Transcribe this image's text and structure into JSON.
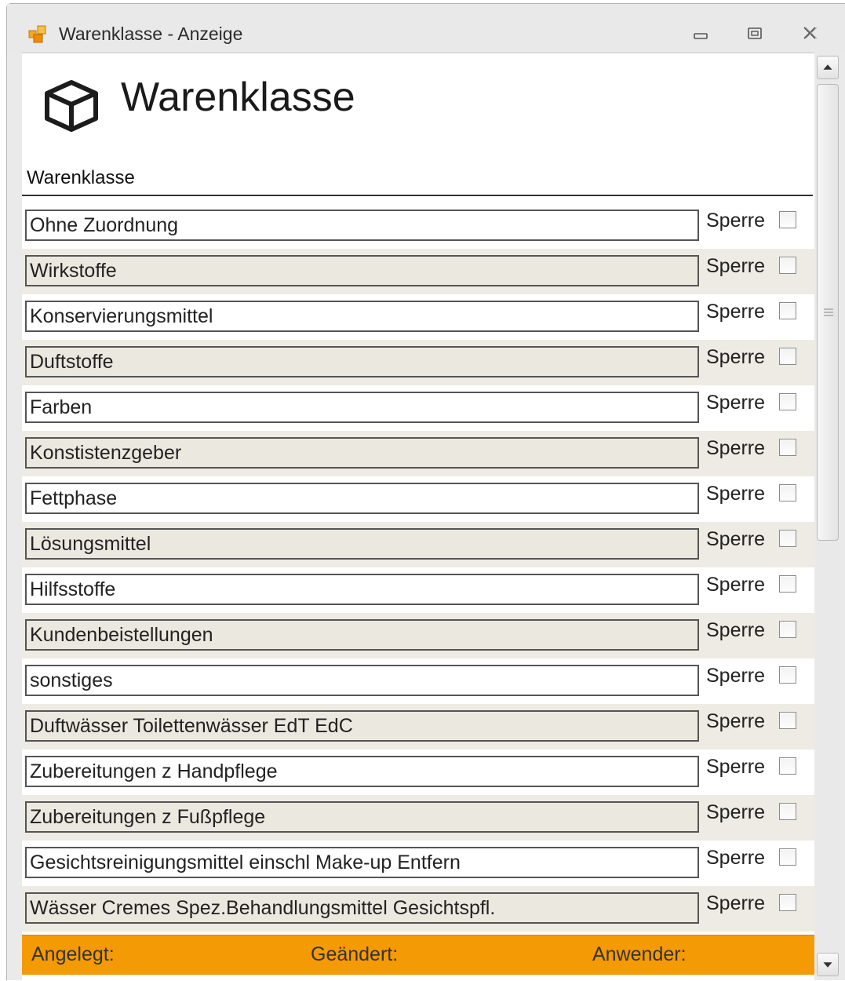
{
  "window": {
    "title": "Warenklasse - Anzeige",
    "icon": "app-icon",
    "controls": [
      "minimize-icon",
      "restore-icon",
      "close-icon"
    ]
  },
  "header": {
    "icon": "cube-icon",
    "title": "Warenklasse"
  },
  "table": {
    "column_header": "Warenklasse",
    "rows": [
      {
        "name": "Ohne Zuordnung",
        "lock_label": "Sperre",
        "locked": false
      },
      {
        "name": "Wirkstoffe",
        "lock_label": "Sperre",
        "locked": false
      },
      {
        "name": "Konservierungsmittel",
        "lock_label": "Sperre",
        "locked": false
      },
      {
        "name": "Duftstoffe",
        "lock_label": "Sperre",
        "locked": false
      },
      {
        "name": "Farben",
        "lock_label": "Sperre",
        "locked": false
      },
      {
        "name": "Konstistenzgeber",
        "lock_label": "Sperre",
        "locked": false
      },
      {
        "name": "Fettphase",
        "lock_label": "Sperre",
        "locked": false
      },
      {
        "name": "Lösungsmittel",
        "lock_label": "Sperre",
        "locked": false
      },
      {
        "name": "Hilfsstoffe",
        "lock_label": "Sperre",
        "locked": false
      },
      {
        "name": "Kundenbeistellungen",
        "lock_label": "Sperre",
        "locked": false
      },
      {
        "name": "sonstiges",
        "lock_label": "Sperre",
        "locked": false
      },
      {
        "name": "Duftwässer Toilettenwässer EdT EdC",
        "lock_label": "Sperre",
        "locked": false
      },
      {
        "name": "Zubereitungen z Handpflege",
        "lock_label": "Sperre",
        "locked": false
      },
      {
        "name": "Zubereitungen z Fußpflege",
        "lock_label": "Sperre",
        "locked": false
      },
      {
        "name": "Gesichtsreinigungsmittel einschl Make-up Entfern",
        "lock_label": "Sperre",
        "locked": false
      },
      {
        "name": "Wässer Cremes Spez.Behandlungsmittel Gesichtspfl.",
        "lock_label": "Sperre",
        "locked": false
      }
    ]
  },
  "footer": {
    "created_label": "Angelegt:",
    "changed_label": "Geändert:",
    "user_label": "Anwender:",
    "background": "#f49a05"
  },
  "colors": {
    "row_alt": "#eeebe4",
    "row_default": "#ffffff",
    "accent_orange": "#f49a05"
  }
}
